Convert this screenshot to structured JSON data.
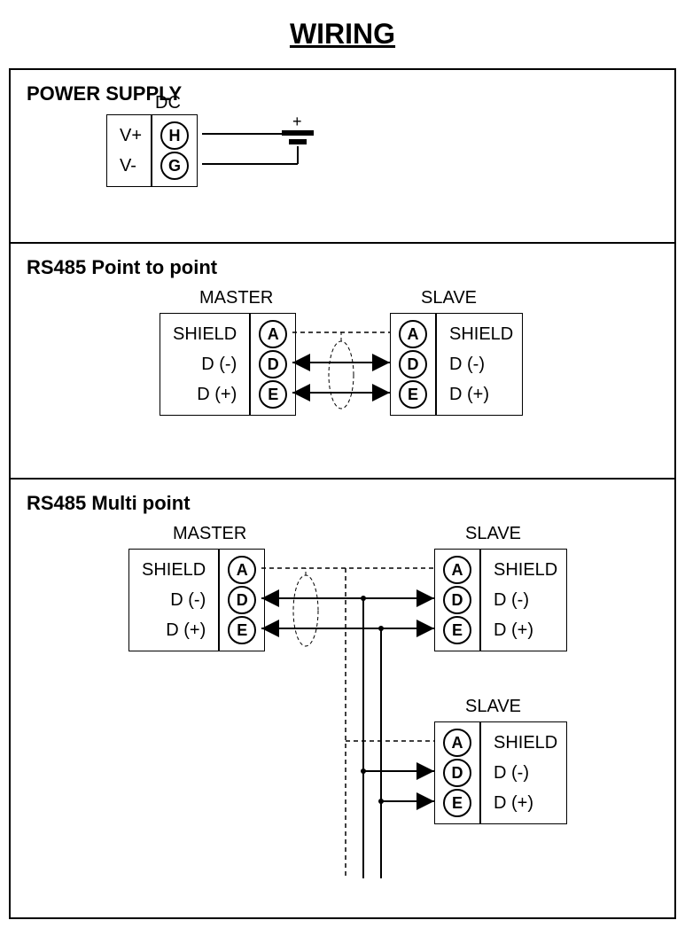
{
  "title": "WIRING",
  "power": {
    "section_title": "POWER SUPPLY",
    "dc_label": "DC",
    "rows": [
      {
        "label": "V+",
        "pin": "H"
      },
      {
        "label": "V-",
        "pin": "G"
      }
    ],
    "plus": "+"
  },
  "ptp": {
    "section_title": "RS485 Point to point",
    "master_label": "MASTER",
    "slave_label": "SLAVE",
    "rows": [
      {
        "label": "SHIELD",
        "pin": "A"
      },
      {
        "label": "D (-)",
        "pin": "D"
      },
      {
        "label": "D (+)",
        "pin": "E"
      }
    ]
  },
  "mp": {
    "section_title": "RS485 Multi point",
    "master_label": "MASTER",
    "slave_label": "SLAVE",
    "rows": [
      {
        "label": "SHIELD",
        "pin": "A"
      },
      {
        "label": "D (-)",
        "pin": "D"
      },
      {
        "label": "D (+)",
        "pin": "E"
      }
    ]
  }
}
